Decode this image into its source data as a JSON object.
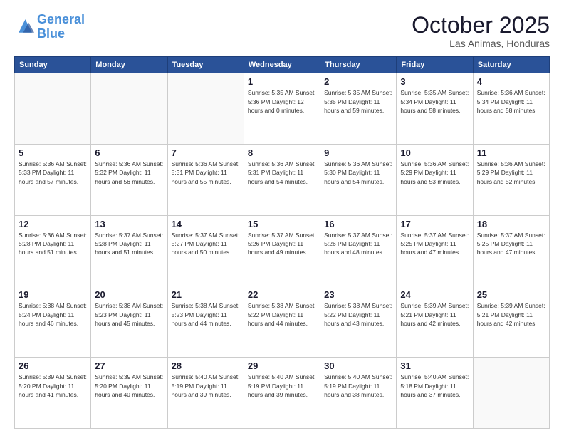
{
  "header": {
    "logo_line1": "General",
    "logo_line2": "Blue",
    "month": "October 2025",
    "location": "Las Animas, Honduras"
  },
  "weekdays": [
    "Sunday",
    "Monday",
    "Tuesday",
    "Wednesday",
    "Thursday",
    "Friday",
    "Saturday"
  ],
  "weeks": [
    [
      {
        "day": "",
        "info": ""
      },
      {
        "day": "",
        "info": ""
      },
      {
        "day": "",
        "info": ""
      },
      {
        "day": "1",
        "info": "Sunrise: 5:35 AM\nSunset: 5:36 PM\nDaylight: 12 hours\nand 0 minutes."
      },
      {
        "day": "2",
        "info": "Sunrise: 5:35 AM\nSunset: 5:35 PM\nDaylight: 11 hours\nand 59 minutes."
      },
      {
        "day": "3",
        "info": "Sunrise: 5:35 AM\nSunset: 5:34 PM\nDaylight: 11 hours\nand 58 minutes."
      },
      {
        "day": "4",
        "info": "Sunrise: 5:36 AM\nSunset: 5:34 PM\nDaylight: 11 hours\nand 58 minutes."
      }
    ],
    [
      {
        "day": "5",
        "info": "Sunrise: 5:36 AM\nSunset: 5:33 PM\nDaylight: 11 hours\nand 57 minutes."
      },
      {
        "day": "6",
        "info": "Sunrise: 5:36 AM\nSunset: 5:32 PM\nDaylight: 11 hours\nand 56 minutes."
      },
      {
        "day": "7",
        "info": "Sunrise: 5:36 AM\nSunset: 5:31 PM\nDaylight: 11 hours\nand 55 minutes."
      },
      {
        "day": "8",
        "info": "Sunrise: 5:36 AM\nSunset: 5:31 PM\nDaylight: 11 hours\nand 54 minutes."
      },
      {
        "day": "9",
        "info": "Sunrise: 5:36 AM\nSunset: 5:30 PM\nDaylight: 11 hours\nand 54 minutes."
      },
      {
        "day": "10",
        "info": "Sunrise: 5:36 AM\nSunset: 5:29 PM\nDaylight: 11 hours\nand 53 minutes."
      },
      {
        "day": "11",
        "info": "Sunrise: 5:36 AM\nSunset: 5:29 PM\nDaylight: 11 hours\nand 52 minutes."
      }
    ],
    [
      {
        "day": "12",
        "info": "Sunrise: 5:36 AM\nSunset: 5:28 PM\nDaylight: 11 hours\nand 51 minutes."
      },
      {
        "day": "13",
        "info": "Sunrise: 5:37 AM\nSunset: 5:28 PM\nDaylight: 11 hours\nand 51 minutes."
      },
      {
        "day": "14",
        "info": "Sunrise: 5:37 AM\nSunset: 5:27 PM\nDaylight: 11 hours\nand 50 minutes."
      },
      {
        "day": "15",
        "info": "Sunrise: 5:37 AM\nSunset: 5:26 PM\nDaylight: 11 hours\nand 49 minutes."
      },
      {
        "day": "16",
        "info": "Sunrise: 5:37 AM\nSunset: 5:26 PM\nDaylight: 11 hours\nand 48 minutes."
      },
      {
        "day": "17",
        "info": "Sunrise: 5:37 AM\nSunset: 5:25 PM\nDaylight: 11 hours\nand 47 minutes."
      },
      {
        "day": "18",
        "info": "Sunrise: 5:37 AM\nSunset: 5:25 PM\nDaylight: 11 hours\nand 47 minutes."
      }
    ],
    [
      {
        "day": "19",
        "info": "Sunrise: 5:38 AM\nSunset: 5:24 PM\nDaylight: 11 hours\nand 46 minutes."
      },
      {
        "day": "20",
        "info": "Sunrise: 5:38 AM\nSunset: 5:23 PM\nDaylight: 11 hours\nand 45 minutes."
      },
      {
        "day": "21",
        "info": "Sunrise: 5:38 AM\nSunset: 5:23 PM\nDaylight: 11 hours\nand 44 minutes."
      },
      {
        "day": "22",
        "info": "Sunrise: 5:38 AM\nSunset: 5:22 PM\nDaylight: 11 hours\nand 44 minutes."
      },
      {
        "day": "23",
        "info": "Sunrise: 5:38 AM\nSunset: 5:22 PM\nDaylight: 11 hours\nand 43 minutes."
      },
      {
        "day": "24",
        "info": "Sunrise: 5:39 AM\nSunset: 5:21 PM\nDaylight: 11 hours\nand 42 minutes."
      },
      {
        "day": "25",
        "info": "Sunrise: 5:39 AM\nSunset: 5:21 PM\nDaylight: 11 hours\nand 42 minutes."
      }
    ],
    [
      {
        "day": "26",
        "info": "Sunrise: 5:39 AM\nSunset: 5:20 PM\nDaylight: 11 hours\nand 41 minutes."
      },
      {
        "day": "27",
        "info": "Sunrise: 5:39 AM\nSunset: 5:20 PM\nDaylight: 11 hours\nand 40 minutes."
      },
      {
        "day": "28",
        "info": "Sunrise: 5:40 AM\nSunset: 5:19 PM\nDaylight: 11 hours\nand 39 minutes."
      },
      {
        "day": "29",
        "info": "Sunrise: 5:40 AM\nSunset: 5:19 PM\nDaylight: 11 hours\nand 39 minutes."
      },
      {
        "day": "30",
        "info": "Sunrise: 5:40 AM\nSunset: 5:19 PM\nDaylight: 11 hours\nand 38 minutes."
      },
      {
        "day": "31",
        "info": "Sunrise: 5:40 AM\nSunset: 5:18 PM\nDaylight: 11 hours\nand 37 minutes."
      },
      {
        "day": "",
        "info": ""
      }
    ]
  ]
}
